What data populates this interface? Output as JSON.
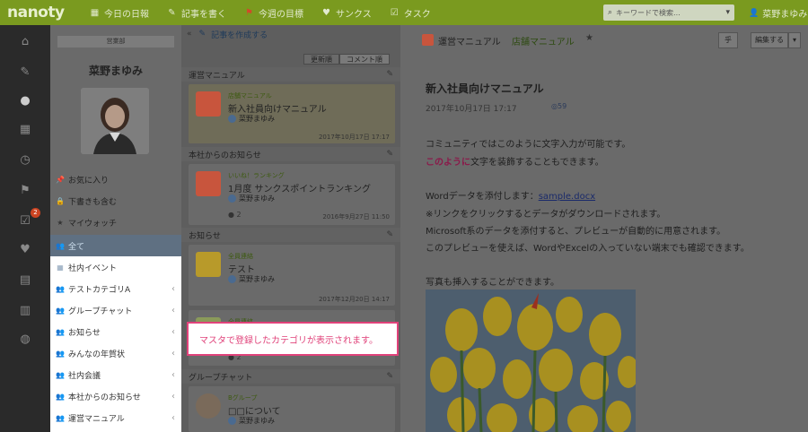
{
  "topbar": {
    "logo": "nanoty",
    "nav": [
      {
        "icon": "calendar-icon",
        "label": "今日の日報"
      },
      {
        "icon": "chat-icon",
        "label": "記事を書く"
      },
      {
        "icon": "flag-icon",
        "label": "今週の目標"
      },
      {
        "icon": "heart-icon",
        "label": "サンクス"
      },
      {
        "icon": "checklist-icon",
        "label": "タスク"
      }
    ],
    "search_placeholder": "キーワードで検索...",
    "user_name": "菜野まゆみ"
  },
  "rail": {
    "icons": [
      "home-icon",
      "edit-icon",
      "chat-icon",
      "calendar-icon",
      "clock-icon",
      "flag-icon",
      "checklist-icon",
      "heart-icon",
      "address-book-icon",
      "chart-icon",
      "globe-icon"
    ],
    "badge": "2"
  },
  "profile": {
    "department": "営業部",
    "name": "菜野まゆみ",
    "menu": [
      {
        "icon": "pin-icon",
        "label": "お気に入り"
      },
      {
        "icon": "lock-icon",
        "label": "下書きも含む"
      },
      {
        "icon": "star-icon",
        "label": "マイウォッチ"
      },
      {
        "icon": "group-icon",
        "label": "全て"
      }
    ],
    "categories": [
      {
        "label": "社内イベント",
        "chevron": false
      },
      {
        "label": "テストカテゴリA",
        "chevron": true
      },
      {
        "label": "グループチャット",
        "chevron": true
      },
      {
        "label": "お知らせ",
        "chevron": true
      },
      {
        "label": "みんなの年賀状",
        "chevron": true
      },
      {
        "label": "社内会議",
        "chevron": true
      },
      {
        "label": "本社からのお知らせ",
        "chevron": true
      },
      {
        "label": "運営マニュアル",
        "chevron": true
      }
    ]
  },
  "middle": {
    "compose": "記事を作成する",
    "sort_tabs": [
      "更新順",
      "コメント順"
    ],
    "sections": [
      {
        "title": "運営マニュアル",
        "card": {
          "category": "店舗マニュアル",
          "title": "新入社員向けマニュアル",
          "user": "菜野まゆみ",
          "date": "2017年10月17日 17:17",
          "comments": ""
        }
      },
      {
        "title": "本社からのお知らせ",
        "card": {
          "category": "いいね！ランキング",
          "title": "1月度 サンクスポイントランキング",
          "user": "菜野まゆみ",
          "date": "2016年9月27日 11:50",
          "comments": "2"
        }
      },
      {
        "title": "お知らせ",
        "card": {
          "category": "全員連絡",
          "title": "テスト",
          "user": "菜野まゆみ",
          "date": "2017年12月20日 14:17",
          "comments": ""
        }
      },
      {
        "title": "",
        "card": {
          "category": "全員連絡",
          "title": "",
          "user": "",
          "date": "",
          "comments": "2"
        }
      },
      {
        "title": "グループチャット",
        "card": {
          "category": "Bグループ",
          "title": "□□について",
          "user": "菜野まゆみ",
          "date": "",
          "comments": ""
        }
      }
    ]
  },
  "article": {
    "category": "運営マニュアル",
    "subcategory": "店舗マニュアル",
    "pin_button": "乎",
    "edit_button": "編集する",
    "title": "新入社員向けマニュアル",
    "date": "2017年10月17日 17:17",
    "views": "◎59",
    "line1": "コミュニティではこのように文字入力が可能です。",
    "line2_pink": "このように",
    "line2_rest": "文字を装飾することもできます。",
    "line3_prefix": "Wordデータを添付します：",
    "line3_link": "sample.docx",
    "line4": "※リンクをクリックするとデータがダウンロードされます。",
    "line5": "Microsoft系のデータを添付すると、プレビューが自動的に用意されます。",
    "line6": "このプレビューを使えば、WordやExcelの入っていない端末でも確認できます。",
    "line7": "写真も挿入することができます。"
  },
  "callout": {
    "text": "マスタで登録したカテゴリが表示されます。"
  },
  "colors": {
    "topbar": "#7a9a1f",
    "callout_border": "#e0427a",
    "active_menu": "#5f7082"
  }
}
